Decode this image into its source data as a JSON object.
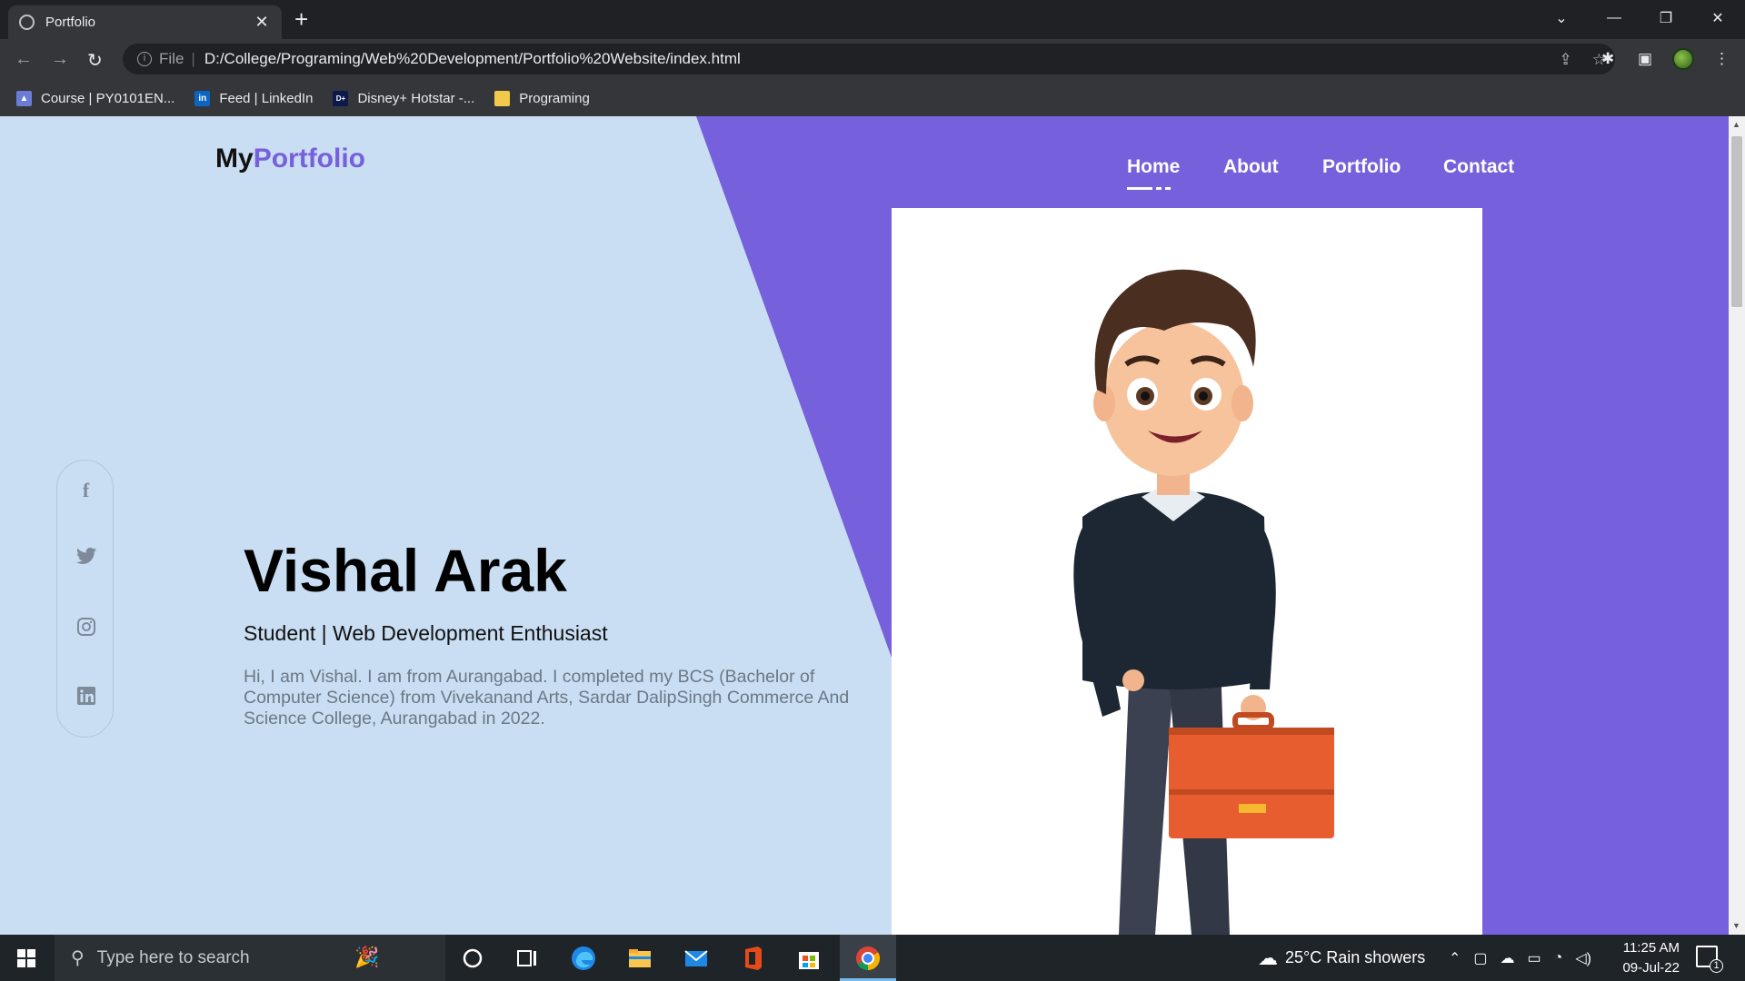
{
  "browser": {
    "tab_title": "Portfolio",
    "tab_close": "✕",
    "new_tab": "+",
    "url_scheme_label": "File",
    "url": "D:/College/Programing/Web%20Development/Portfolio%20Website/index.html",
    "bookmarks": [
      {
        "label": "Course | PY0101EN...",
        "icon": "course-icon",
        "color": "#6b7cd6"
      },
      {
        "label": "Feed | LinkedIn",
        "icon": "linkedin-icon",
        "color": "#0a66c2"
      },
      {
        "label": "Disney+ Hotstar -...",
        "icon": "hotstar-icon",
        "color": "#0c1a4b"
      },
      {
        "label": "Programing",
        "icon": "folder-icon",
        "color": "#f2c94c"
      }
    ]
  },
  "site": {
    "logo_prefix": "My",
    "logo_accent": "Portfolio",
    "nav": [
      "Home",
      "About",
      "Portfolio",
      "Contact"
    ],
    "active_nav": "Home",
    "social": [
      "facebook-icon",
      "twitter-icon",
      "instagram-icon",
      "linkedin-icon"
    ],
    "name": "Vishal Arak",
    "subtitle": "Student | Web Development Enthusiast",
    "description": "Hi, I am Vishal. I am from Aurangabad. I completed my BCS (Bachelor of Computer Science) from Vivekanand Arts, Sardar DalipSingh Commerce And Science College, Aurangabad in 2022.",
    "colors": {
      "accent": "#7660db",
      "background": "#c9def3"
    }
  },
  "taskbar": {
    "search_placeholder": "Type here to search",
    "weather": "25°C  Rain showers",
    "time": "11:25 AM",
    "date": "09-Jul-22",
    "notification_count": "1"
  }
}
